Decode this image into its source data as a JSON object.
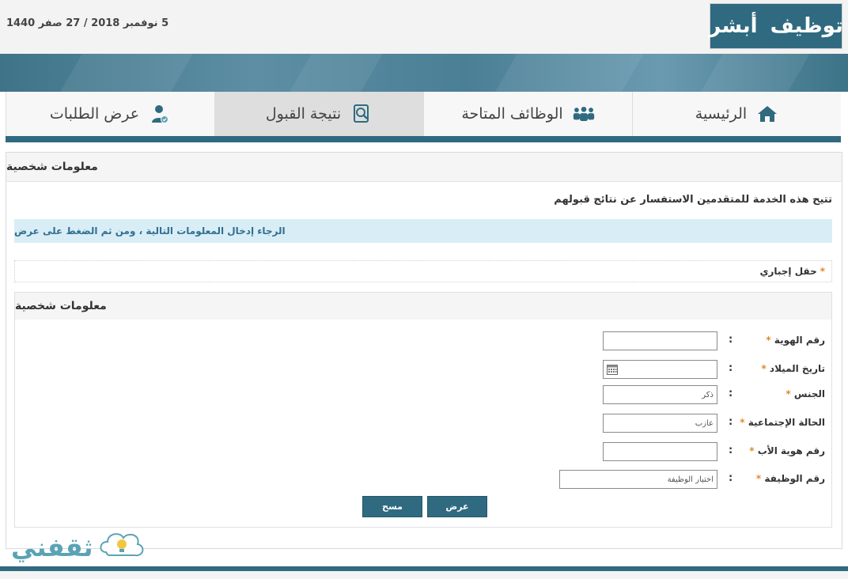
{
  "header": {
    "date": "5 نوفمبر 2018 / 27 صفر 1440",
    "logo_part1": "أبشر",
    "logo_part2": "توظيف"
  },
  "nav": [
    {
      "label": "الرئيسية",
      "icon": "home-icon"
    },
    {
      "label": "الوظائف المتاحة",
      "icon": "people-group-icon"
    },
    {
      "label": "نتيجة القبول",
      "icon": "search-doc-icon",
      "active": true
    },
    {
      "label": "عرض الطلبات",
      "icon": "user-check-icon"
    }
  ],
  "panel": {
    "title": "معلومات شخصية",
    "intro": "تتيح هذه الخدمة للمتقدمين الاستفسار عن نتائج قبولهم",
    "info": "الرجاء إدخال المعلومات التالية ، ومن ثم الضغط على عرض",
    "required_note": "حقل إجباري",
    "subpanel_title": "معلومات شخصية"
  },
  "form": {
    "colon": ":",
    "star": "*",
    "id_label": "رقم الهوية",
    "id_value": "",
    "dob_label": "تاريخ الميلاد",
    "dob_value": "",
    "gender_label": "الجنس",
    "gender_value": "ذكر",
    "marital_label": "الحالة الإجتماعية",
    "marital_value": "عازب",
    "father_id_label": "رقم هوية الأب",
    "father_id_value": "",
    "job_label": "رقم الوظيفة",
    "job_value": "اختيار الوظيفة"
  },
  "buttons": {
    "show": "عرض",
    "clear": "مسح"
  },
  "watermark": {
    "text": "ثقفني"
  },
  "colors": {
    "primary": "#2f6a80",
    "info_bg": "#d9edf7",
    "info_text": "#31708f",
    "required_star": "#e08a2b"
  }
}
